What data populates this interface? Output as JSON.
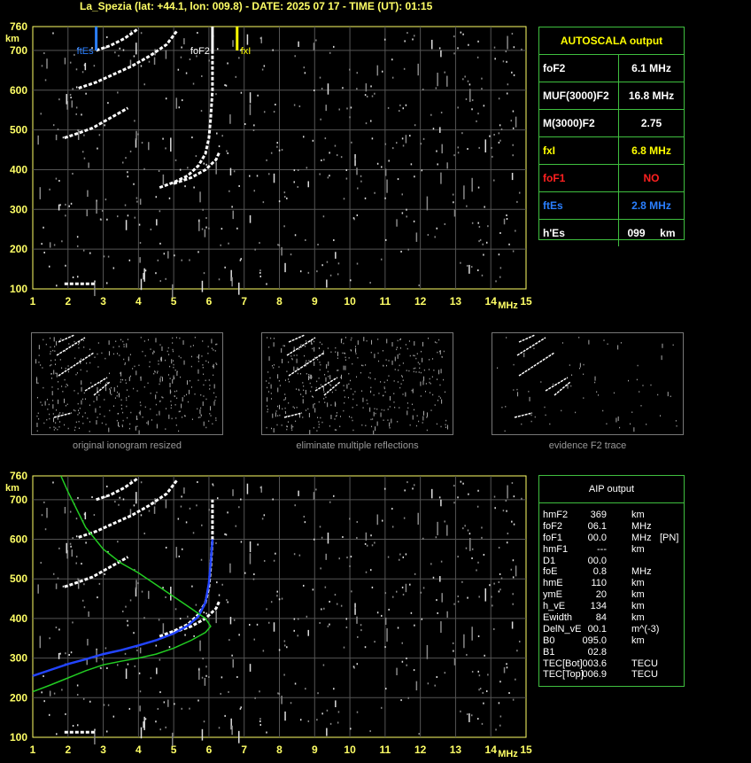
{
  "header": "La_Spezia (lat: +44.1, lon: 009.8) - DATE: 2025 07 17 - TIME (UT): 01:15",
  "chart_data": [
    {
      "type": "scatter",
      "title": "",
      "xlabel": "MHz",
      "ylabel": "km",
      "xlim": [
        1,
        15
      ],
      "ylim": [
        100,
        760
      ],
      "x_ticks": [
        "1",
        "2",
        "3",
        "4",
        "5",
        "6",
        "7",
        "8",
        "9",
        "10",
        "11",
        "12",
        "13",
        "14",
        "15"
      ],
      "y_ticks": [
        "760",
        "700",
        "600",
        "500",
        "400",
        "300",
        "200",
        "100"
      ],
      "grid": true,
      "markers": [
        {
          "label": "ftEs",
          "x": 2.8,
          "color": "#2a7fff"
        },
        {
          "label": "foF2",
          "x": 6.1,
          "color": "#ffffff"
        },
        {
          "label": "fxI",
          "x": 6.8,
          "color": "#ffff00"
        }
      ],
      "traces": [
        {
          "name": "o-trace",
          "points": [
            [
              4.6,
              355
            ],
            [
              5.0,
              368
            ],
            [
              5.4,
              385
            ],
            [
              5.7,
              410
            ],
            [
              5.9,
              440
            ],
            [
              6.0,
              480
            ],
            [
              6.05,
              530
            ],
            [
              6.1,
              600
            ],
            [
              6.1,
              700
            ]
          ]
        },
        {
          "name": "x-trace",
          "points": [
            [
              5.0,
              365
            ],
            [
              5.5,
              380
            ],
            [
              5.9,
              400
            ],
            [
              6.2,
              425
            ],
            [
              6.3,
              445
            ]
          ]
        },
        {
          "name": "Es-1",
          "points": [
            [
              1.9,
              113
            ],
            [
              2.2,
              113
            ],
            [
              2.5,
              113
            ],
            [
              2.8,
              113
            ]
          ]
        },
        {
          "name": "Es-2",
          "points": [
            [
              1.9,
              480
            ],
            [
              2.3,
              492
            ],
            [
              2.7,
              505
            ],
            [
              3.1,
              525
            ],
            [
              3.5,
              545
            ],
            [
              3.7,
              555
            ]
          ]
        },
        {
          "name": "Es-3",
          "points": [
            [
              2.3,
              605
            ],
            [
              2.8,
              620
            ],
            [
              3.3,
              640
            ],
            [
              3.8,
              660
            ],
            [
              4.3,
              685
            ],
            [
              4.8,
              715
            ],
            [
              5.1,
              750
            ]
          ]
        },
        {
          "name": "Es-4",
          "points": [
            [
              2.8,
              700
            ],
            [
              3.2,
              712
            ],
            [
              3.6,
              730
            ],
            [
              4.0,
              755
            ]
          ]
        }
      ]
    },
    {
      "type": "line",
      "title": "",
      "xlabel": "MHz",
      "ylabel": "km",
      "xlim": [
        1,
        15
      ],
      "ylim": [
        100,
        760
      ],
      "x_ticks": [
        "1",
        "2",
        "3",
        "4",
        "5",
        "6",
        "7",
        "8",
        "9",
        "10",
        "11",
        "12",
        "13",
        "14",
        "15"
      ],
      "y_ticks": [
        "760",
        "700",
        "600",
        "500",
        "400",
        "300",
        "200",
        "100"
      ],
      "grid": true,
      "series": [
        {
          "color": "#2244ff",
          "points": [
            [
              1.0,
              255
            ],
            [
              1.5,
              270
            ],
            [
              2.0,
              285
            ],
            [
              2.5,
              297
            ],
            [
              3.0,
              310
            ],
            [
              3.5,
              320
            ],
            [
              4.0,
              332
            ],
            [
              4.5,
              345
            ],
            [
              5.0,
              362
            ],
            [
              5.4,
              382
            ],
            [
              5.7,
              405
            ],
            [
              5.9,
              440
            ],
            [
              6.0,
              490
            ],
            [
              6.05,
              540
            ],
            [
              6.1,
              600
            ]
          ]
        },
        {
          "color": "#22cc22",
          "points": [
            [
              1.0,
              215
            ],
            [
              1.5,
              232
            ],
            [
              2.0,
              250
            ],
            [
              2.5,
              268
            ],
            [
              3.0,
              283
            ],
            [
              3.5,
              292
            ],
            [
              4.0,
              300
            ],
            [
              4.5,
              310
            ],
            [
              5.0,
              325
            ],
            [
              5.5,
              345
            ],
            [
              5.9,
              365
            ],
            [
              6.05,
              380
            ],
            [
              5.9,
              400
            ],
            [
              5.5,
              425
            ],
            [
              5.0,
              455
            ],
            [
              4.5,
              485
            ],
            [
              4.0,
              515
            ],
            [
              3.5,
              540
            ],
            [
              3.0,
              575
            ],
            [
              2.5,
              630
            ],
            [
              2.0,
              720
            ],
            [
              1.8,
              760
            ]
          ]
        }
      ]
    }
  ],
  "autoscala": {
    "title": "AUTOSCALA output",
    "rows": [
      {
        "k": "foF2",
        "v": "6.1 MHz",
        "kc": "#ffffff",
        "vc": "#ffffff"
      },
      {
        "k": "MUF(3000)F2",
        "v": "16.8 MHz",
        "kc": "#ffffff",
        "vc": "#ffffff"
      },
      {
        "k": "M(3000)F2",
        "v": "2.75",
        "kc": "#ffffff",
        "vc": "#ffffff"
      },
      {
        "k": "fxI",
        "v": "6.8 MHz",
        "kc": "#ffff00",
        "vc": "#ffff00"
      },
      {
        "k": "foF1",
        "v": "NO",
        "kc": "#ff2020",
        "vc": "#ff2020"
      },
      {
        "k": "ftEs",
        "v": "2.8 MHz",
        "kc": "#2a7fff",
        "vc": "#2a7fff"
      },
      {
        "k": "h'Es",
        "v": "099     km",
        "kc": "#ffffff",
        "vc": "#ffffff"
      }
    ]
  },
  "aip": {
    "title": "AIP output",
    "rows": [
      {
        "a": "hmF2",
        "b": "369",
        "c": "km",
        "d": ""
      },
      {
        "a": "foF2",
        "b": "06.1",
        "c": "MHz",
        "d": ""
      },
      {
        "a": "foF1",
        "b": "00.0",
        "c": "MHz",
        "d": "[PN]"
      },
      {
        "a": "hmF1",
        "b": "---",
        "c": "km",
        "d": ""
      },
      {
        "a": "D1",
        "b": "00.0",
        "c": "",
        "d": ""
      },
      {
        "a": "foE",
        "b": "0.8",
        "c": "MHz",
        "d": ""
      },
      {
        "a": "hmE",
        "b": "110",
        "c": "km",
        "d": ""
      },
      {
        "a": "ymE",
        "b": "20",
        "c": "km",
        "d": ""
      },
      {
        "a": "h_vE",
        "b": "134",
        "c": "km",
        "d": ""
      },
      {
        "a": "Ewidth",
        "b": "84",
        "c": "km",
        "d": ""
      },
      {
        "a": "DelN_vE",
        "b": "00.1",
        "c": "m^(-3)",
        "d": ""
      },
      {
        "a": "B0",
        "b": "095.0",
        "c": "km",
        "d": ""
      },
      {
        "a": "B1",
        "b": "02.8",
        "c": "",
        "d": ""
      },
      {
        "a": "TEC[Bot]",
        "b": "003.6",
        "c": "TECU",
        "d": ""
      },
      {
        "a": "TEC[Top]",
        "b": "006.9",
        "c": "TECU",
        "d": ""
      }
    ]
  },
  "thumbnails": [
    {
      "caption": "original ionogram resized"
    },
    {
      "caption": "eliminate multiple reflections"
    },
    {
      "caption": "evidence F2 trace"
    }
  ]
}
